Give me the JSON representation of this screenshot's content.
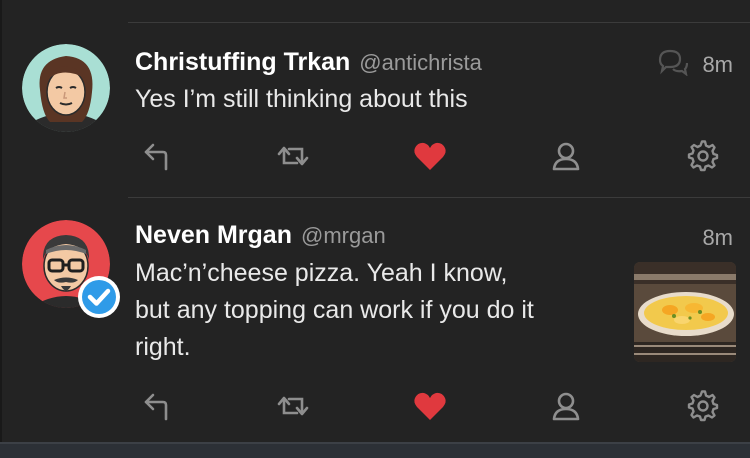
{
  "tweets": [
    {
      "name": "Christuffing Trkan",
      "handle": "@antichrista",
      "time": "8m",
      "text": "Yes I’m still thinking about this",
      "has_conversation_icon": true,
      "liked": true
    },
    {
      "name": "Neven Mrgan",
      "handle": "@mrgan",
      "time": "8m",
      "text_lines": [
        "Mac’n’cheese pizza. Yeah I know,",
        "but any topping can work if you do it",
        "right."
      ],
      "verified": true,
      "has_media": true,
      "liked": true
    }
  ],
  "icons": {
    "reply": "reply-icon",
    "retweet": "retweet-icon",
    "like": "heart-icon",
    "profile": "user-icon",
    "settings": "gear-icon",
    "conversation": "conversation-icon",
    "verified": "verified-badge-icon"
  },
  "colors": {
    "background": "#232323",
    "like_red": "#e0393e",
    "icon_grey": "#8e8e8e",
    "verified_blue": "#2f9be8",
    "avatar1_bg": "#a9dfd4",
    "avatar2_bg": "#e6484c"
  }
}
